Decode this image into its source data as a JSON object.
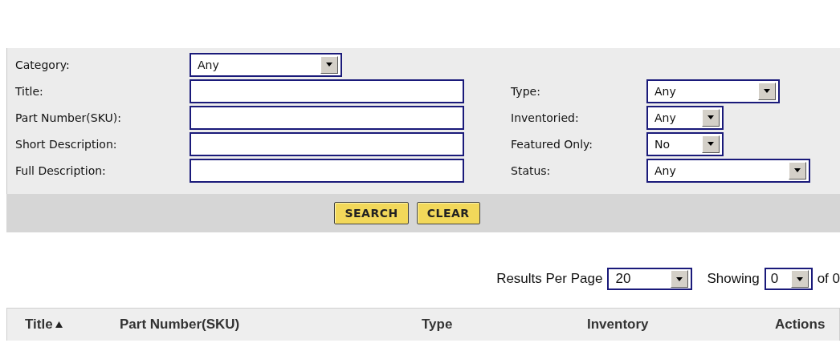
{
  "search_form": {
    "left_fields": [
      {
        "label": "Category:",
        "kind": "select",
        "value": "Any"
      },
      {
        "label": "Title:",
        "kind": "text"
      },
      {
        "label": "Part Number(SKU):",
        "kind": "text"
      },
      {
        "label": "Short Description:",
        "kind": "text"
      },
      {
        "label": "Full Description:",
        "kind": "text"
      }
    ],
    "right_fields": [
      {
        "label": "Type:",
        "kind": "select",
        "value": "Any"
      },
      {
        "label": "Inventoried:",
        "kind": "select",
        "value": "Any"
      },
      {
        "label": "Featured Only:",
        "kind": "select",
        "value": "No"
      },
      {
        "label": "Status:",
        "kind": "select",
        "value": "Any"
      }
    ],
    "buttons": [
      "SEARCH",
      "CLEAR"
    ]
  },
  "results": {
    "per_page_label": "Results Per Page",
    "per_page": "20",
    "showing_label": "Showing",
    "showing": "0",
    "total": "of 0"
  },
  "table": {
    "columns": [
      {
        "label": "Title",
        "sorted": true
      },
      {
        "label": "Part Number(SKU)",
        "sorted": false
      },
      {
        "label": "Type",
        "sorted": false
      },
      {
        "label": "Inventory",
        "sorted": false
      },
      {
        "label": "Actions",
        "sorted": false
      }
    ]
  }
}
